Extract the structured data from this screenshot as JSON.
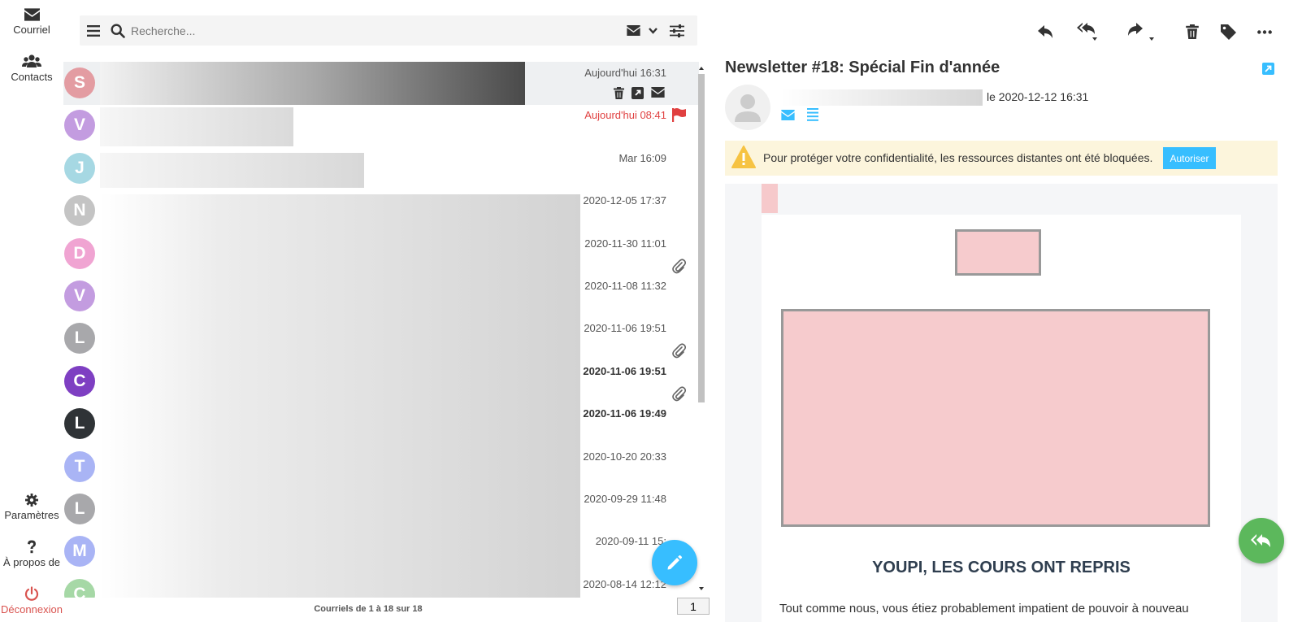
{
  "nav": {
    "mail": "Courriel",
    "contacts": "Contacts",
    "settings": "Paramètres",
    "about": "À propos de",
    "logout": "Déconnexion"
  },
  "search": {
    "placeholder": "Recherche..."
  },
  "messages": [
    {
      "initial": "S",
      "color": "#e39ca2",
      "date": "Aujourd'hui 16:31",
      "style": "normal"
    },
    {
      "initial": "V",
      "color": "#c39ce0",
      "date": "Aujourd'hui 08:41",
      "style": "red"
    },
    {
      "initial": "J",
      "color": "#a6d8e3",
      "date": "Mar 16:09",
      "style": "normal"
    },
    {
      "initial": "N",
      "color": "#c4c4c4",
      "date": "2020-12-05 17:37",
      "style": "normal"
    },
    {
      "initial": "D",
      "color": "#f0a4d2",
      "date": "2020-11-30 11:01",
      "style": "normal"
    },
    {
      "initial": "V",
      "color": "#c39ce0",
      "date": "2020-11-08 11:32",
      "style": "normal"
    },
    {
      "initial": "L",
      "color": "#a8a8ab",
      "date": "2020-11-06 19:51",
      "style": "normal"
    },
    {
      "initial": "C",
      "color": "#7e3fc2",
      "date": "2020-11-06 19:51",
      "style": "bold"
    },
    {
      "initial": "L",
      "color": "#2f3336",
      "date": "2020-11-06 19:49",
      "style": "bold"
    },
    {
      "initial": "T",
      "color": "#a9b4f5",
      "date": "2020-10-20 20:33",
      "style": "normal"
    },
    {
      "initial": "L",
      "color": "#a8a8ab",
      "date": "2020-09-29 11:48",
      "style": "normal"
    },
    {
      "initial": "M",
      "color": "#a9b4f5",
      "date": "2020-09-11 15:",
      "style": "normal"
    },
    {
      "initial": "C",
      "color": "#a6d8a6",
      "date": "2020-08-14 12:12",
      "style": "normal"
    }
  ],
  "list_footer": {
    "count": "Courriels de 1 à 18 sur 18",
    "page": "1"
  },
  "preview": {
    "subject": "Newsletter #18: Spécial Fin d'année",
    "date": "le 2020-12-12 16:31",
    "warning": "Pour protéger votre confidentialité, les ressources distantes ont été bloquées.",
    "allow_button": "Autoriser",
    "headline": "YOUPI, LES COURS ONT REPRIS",
    "body_text": "Tout comme nous, vous étiez probablement impatient de pouvoir à nouveau"
  },
  "colors": {
    "accent": "#37beff",
    "reply_fab": "#5cb85c",
    "warning_bg": "#fcf5dc",
    "flag": "#e04040"
  }
}
